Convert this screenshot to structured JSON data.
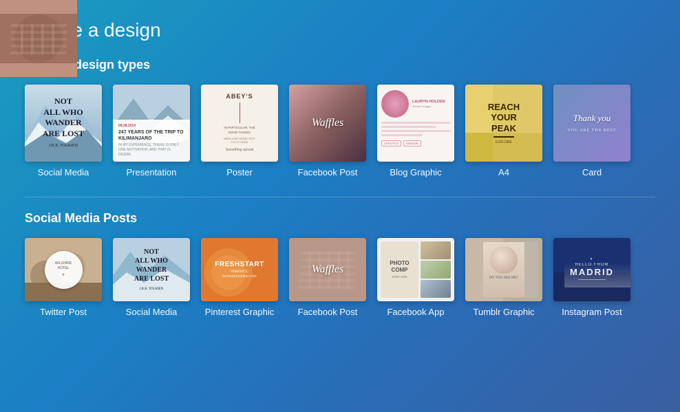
{
  "page": {
    "title": "Create a design"
  },
  "popular": {
    "section_title": "Popular design types",
    "items": [
      {
        "id": "social-media",
        "label": "Social Media",
        "type": "social-media"
      },
      {
        "id": "presentation",
        "label": "Presentation",
        "type": "presentation"
      },
      {
        "id": "poster",
        "label": "Poster",
        "type": "poster"
      },
      {
        "id": "facebook-post",
        "label": "Facebook Post",
        "type": "facebook-pop"
      },
      {
        "id": "blog-graphic",
        "label": "Blog Graphic",
        "type": "blog"
      },
      {
        "id": "a4",
        "label": "A4",
        "type": "a4"
      },
      {
        "id": "card",
        "label": "Card",
        "type": "card"
      }
    ]
  },
  "social_media_posts": {
    "section_title": "Social Media Posts",
    "items": [
      {
        "id": "twitter-post",
        "label": "Twitter Post",
        "type": "twitter"
      },
      {
        "id": "social-media-2",
        "label": "Social Media",
        "type": "sm2"
      },
      {
        "id": "pinterest-graphic",
        "label": "Pinterest Graphic",
        "type": "pinterest"
      },
      {
        "id": "facebook-post-2",
        "label": "Facebook Post",
        "type": "fb-post"
      },
      {
        "id": "facebook-app",
        "label": "Facebook App",
        "type": "fb-app"
      },
      {
        "id": "tumblr-graphic",
        "label": "Tumblr Graphic",
        "type": "tumblr"
      },
      {
        "id": "instagram-post",
        "label": "Instagram Post",
        "type": "instagram"
      }
    ]
  },
  "thumbnails": {
    "social_media_text": "NOT ALL WHO WANDER ARE LOST",
    "social_media_author": "J.R.R. TOLKIEN",
    "poster_title": "ABEY'S",
    "facebook_text": "Waffles",
    "blog_name": "LAURYN HOLDEN",
    "a4_text": "REACH YOUR PEAK",
    "card_text": "Thank you",
    "pinterest_line1": "FRESHSTART",
    "instagram_hello": "HELLO FROM",
    "instagram_city": "MADRID"
  }
}
